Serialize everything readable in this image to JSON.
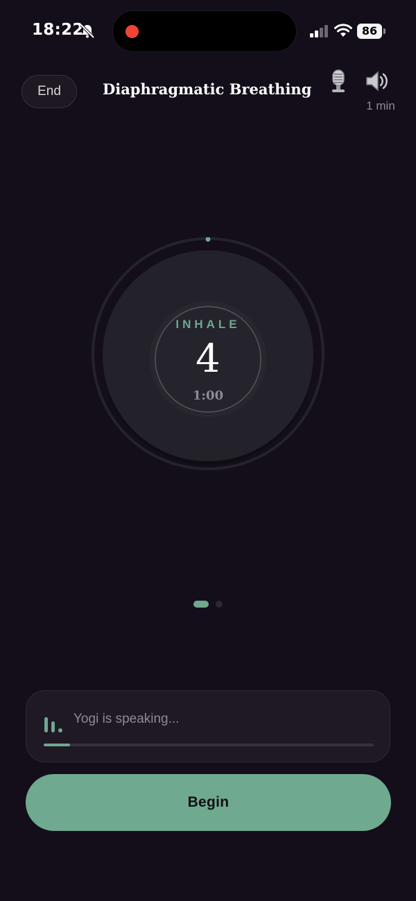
{
  "status_bar": {
    "time": "18:22",
    "battery": "86",
    "icons": [
      "bell-slash-icon",
      "recording-dot",
      "cellular-signal-icon",
      "wifi-icon",
      "battery-icon"
    ],
    "record_color": "#ef4435"
  },
  "header": {
    "end_label": "End",
    "title": "Diaphragmatic Breathing",
    "icons": [
      "microphone-icon",
      "speaker-icon"
    ],
    "duration": "1 min"
  },
  "breathing": {
    "phase": "INHALE",
    "count": "4",
    "timer": "1:00"
  },
  "pagination": {
    "pages": 2,
    "active": 1
  },
  "speaking": {
    "text": "Yogi is speaking...",
    "icon": "audio-bars-icon",
    "progress": 0.08
  },
  "actions": {
    "begin_label": "Begin"
  },
  "colors": {
    "background": "#140e1b",
    "accent": "#6fa990",
    "card": "#1e1924",
    "circle": "#23222b"
  }
}
